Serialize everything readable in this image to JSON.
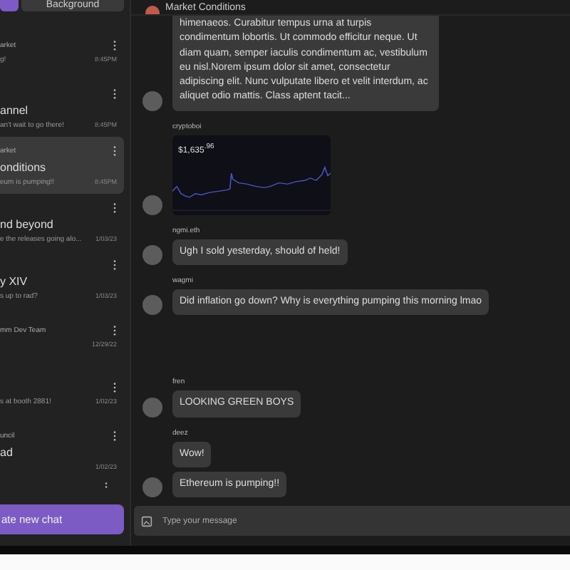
{
  "sidebar": {
    "tabs": [
      {
        "selected": true
      },
      {
        "label": "Background",
        "selected": false
      }
    ],
    "chats": [
      {
        "group": "arket",
        "preview": "g!",
        "time": "8:45PM",
        "selected": false
      },
      {
        "title": "annel",
        "preview": "an't wait to go there!",
        "time": "8:45PM",
        "selected": false
      },
      {
        "group": "arket",
        "title": "onditions",
        "preview": "eum is pumping!!",
        "time": "8:45PM",
        "selected": true
      },
      {
        "title": "nd beyond",
        "preview": "e the releases going alo...",
        "time": "1/03/23",
        "selected": false
      },
      {
        "title": "y XIV",
        "preview": "s up to rad?",
        "time": "1/03/23",
        "selected": false
      },
      {
        "group": "mm Dev Team",
        "time": "12/29/22",
        "selected": false
      },
      {
        "preview": "s at booth 2881!",
        "time": "1/02/23",
        "selected": false
      },
      {
        "group": "uncil",
        "title": "ad",
        "time": "1/02/23",
        "selected": false
      }
    ],
    "new_chat_button": "ate new chat"
  },
  "header": {
    "title": "Market Conditions"
  },
  "messages": [
    {
      "kind": "text",
      "bubbles": [
        "himenaeos. Curabitur tempus urna at turpis condimentum lobortis. Ut commodo efficitur neque. Ut diam quam, semper iaculis condimentum ac, vestibulum eu nisl.Norem ipsum dolor sit amet, consectetur adipiscing elit. Nunc vulputate libero et velit interdum, ac aliquet odio mattis. Class aptent tacit..."
      ]
    },
    {
      "kind": "chart",
      "author": "cryptoboi",
      "price": "$1,635$^{.96}$"
    },
    {
      "kind": "text",
      "author": "ngmi.eth",
      "bubbles": [
        "Ugh I sold yesterday, should of held!"
      ]
    },
    {
      "kind": "text",
      "author": "wagmi",
      "bubbles": [
        "Did inflation go down? Why is everything pumping this morning lmao"
      ]
    },
    {
      "kind": "text",
      "author": "fren",
      "bubbles": [
        "LOOKING GREEN BOYS"
      ]
    },
    {
      "kind": "text",
      "author": "deez",
      "bubbles": [
        "Wow!",
        "Ethereum is pumping!!"
      ]
    }
  ],
  "composer": {
    "placeholder": "Type your message"
  }
}
